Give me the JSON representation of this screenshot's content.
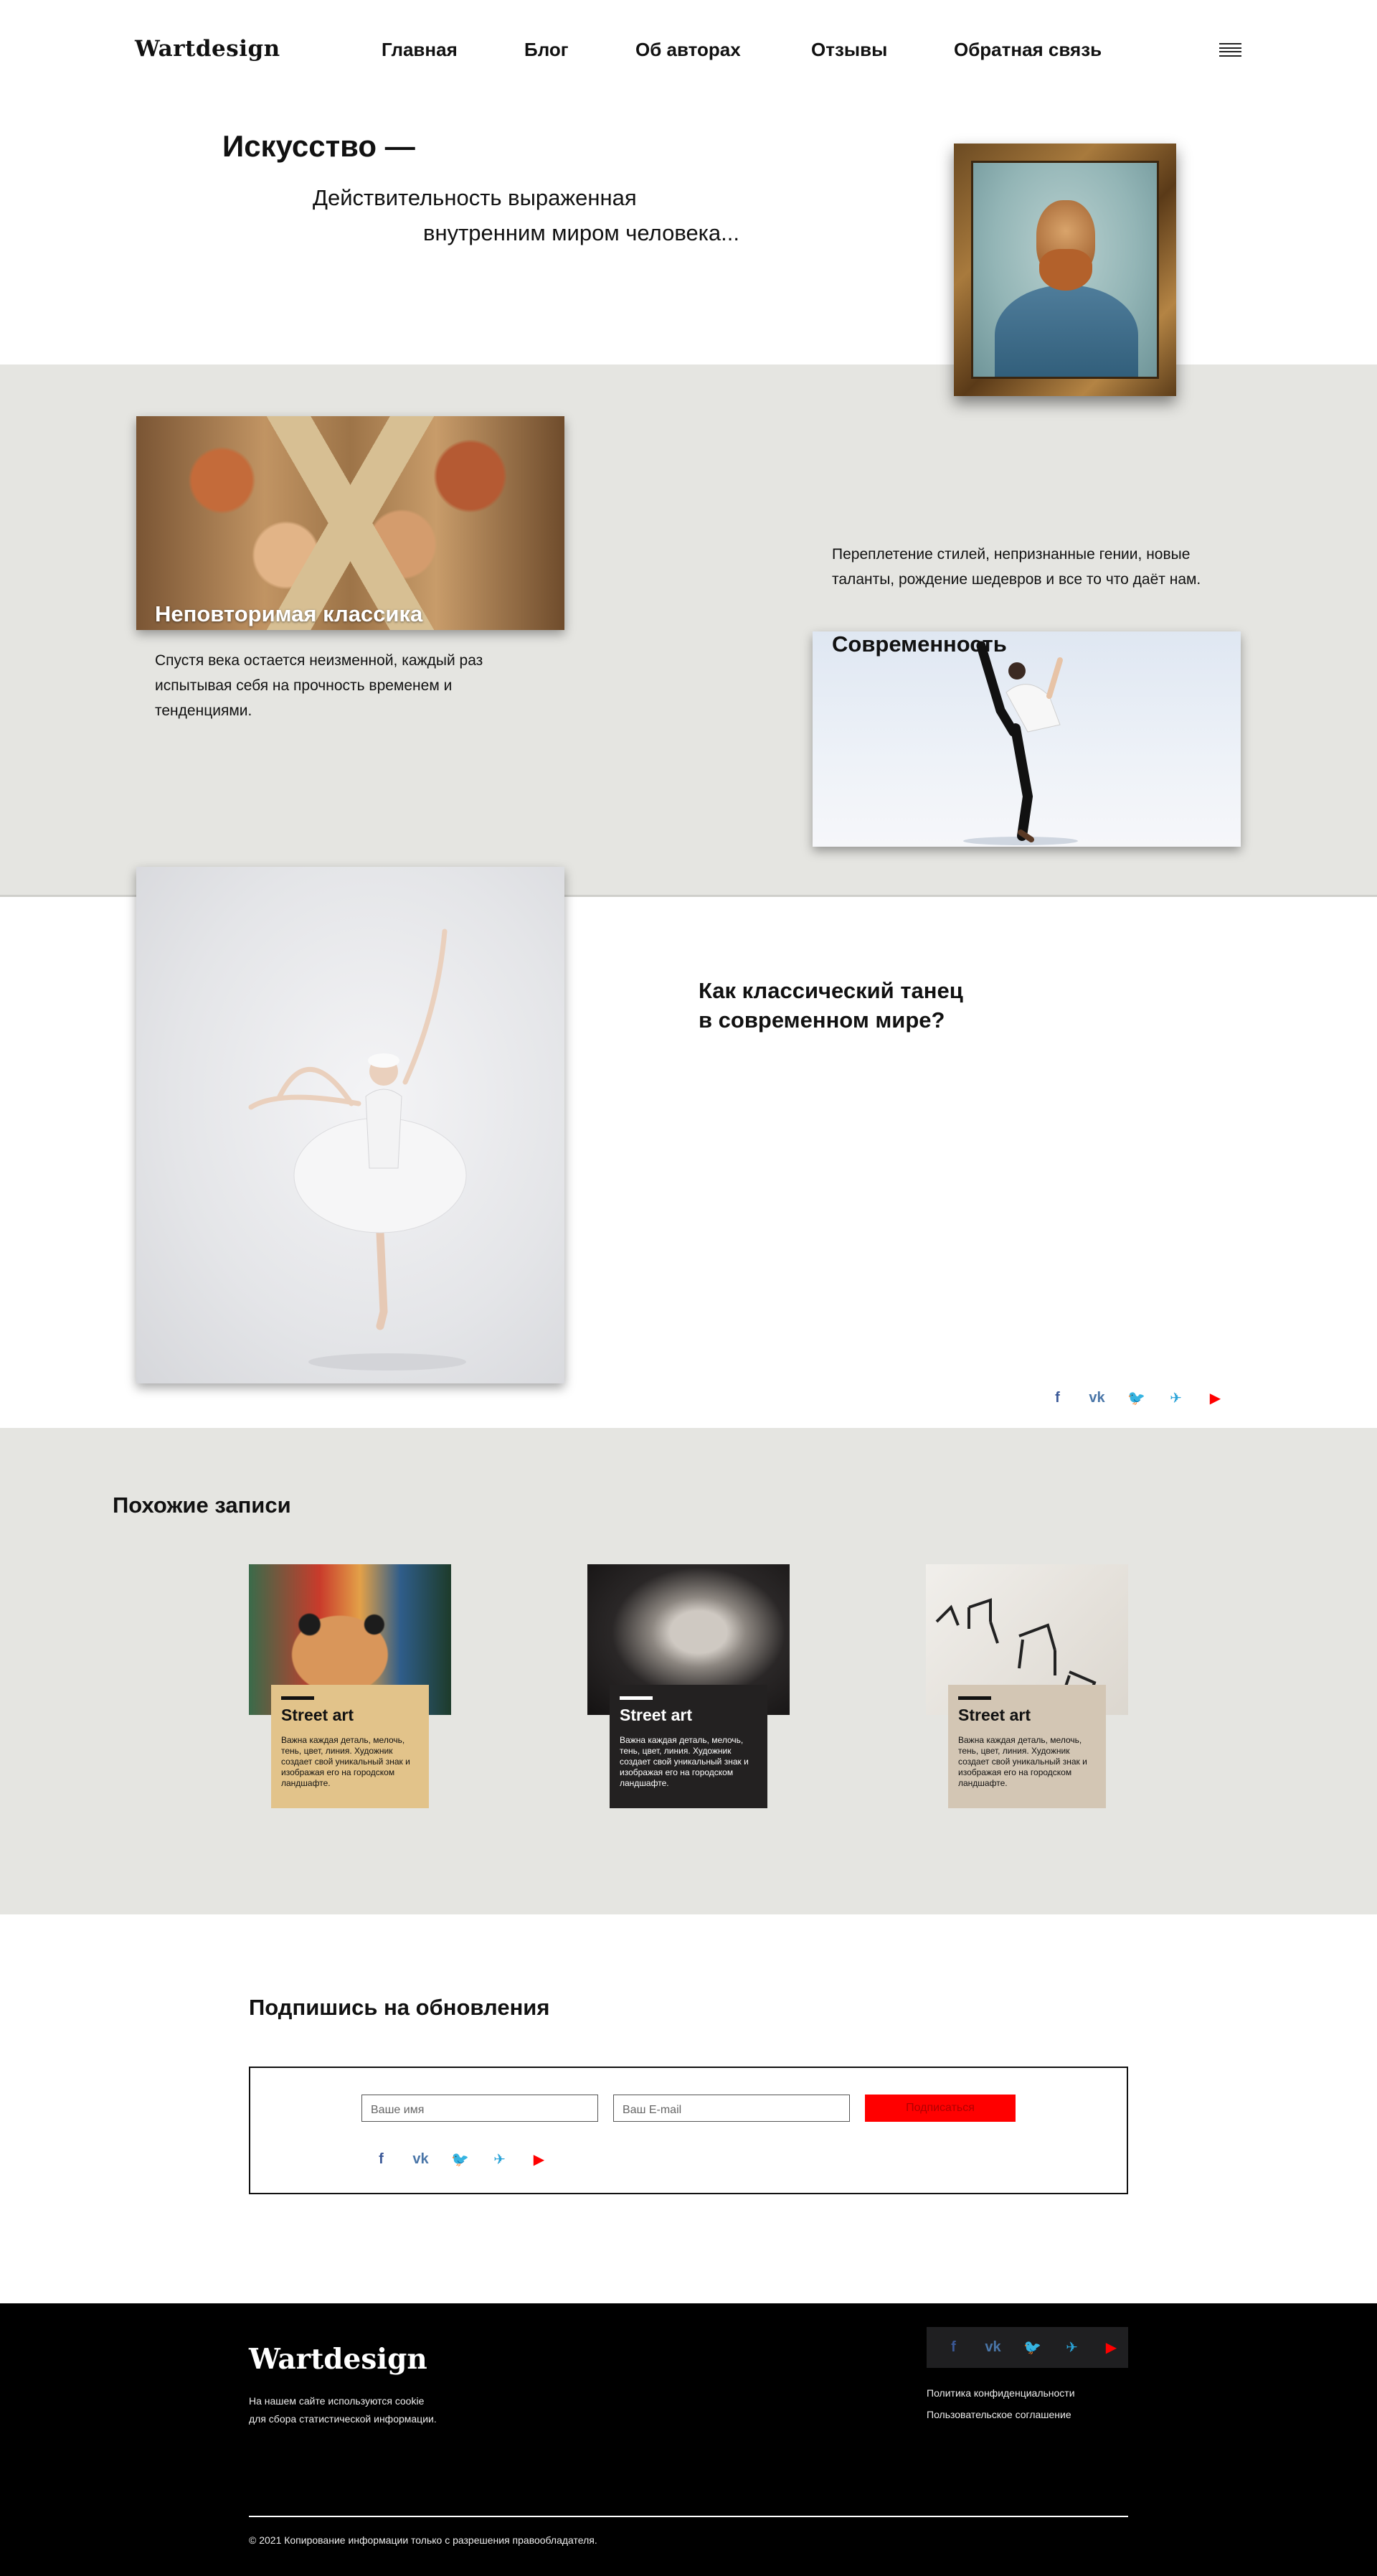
{
  "header": {
    "logo": "Wartdesign",
    "nav": [
      "Главная",
      "Блог",
      "Об авторах",
      "Отзывы",
      "Обратная связь"
    ]
  },
  "hero": {
    "title": "Искусство —",
    "line1": "Действительность выраженная",
    "line2": "внутренним миром человека..."
  },
  "features": {
    "classic_title": "Неповторимая классика",
    "classic_text": "Спустя века остается неизменной, каждый раз испытывая себя на прочность временем и тенденциями.",
    "modern_title": "Современность",
    "modern_text": "Переплетение стилей, непризнанные гении, новые таланты, рождение шедевров и все то что даёт нам."
  },
  "article": {
    "title_line1": "Как классический танец",
    "title_line2": "в современном мире?"
  },
  "social_icons": [
    "facebook-icon",
    "vk-icon",
    "twitter-icon",
    "telegram-icon",
    "youtube-icon"
  ],
  "social_glyphs": {
    "facebook": "f",
    "vk": "vk",
    "twitter": "🐦",
    "telegram": "✈",
    "youtube": "▶"
  },
  "related": {
    "title": "Похожие записи",
    "cards": [
      {
        "title": "Street art",
        "text": "Важна каждая деталь, мелочь, тень, цвет, линия. Художник создает свой уникальный знак и изображая его на городском ландшафте."
      },
      {
        "title": "Street art",
        "text": "Важна каждая деталь, мелочь, тень, цвет, линия. Художник создает свой уникальный знак и изображая его на городском ландшафте."
      },
      {
        "title": "Street art",
        "text": "Важна каждая деталь, мелочь, тень, цвет, линия. Художник создает свой уникальный знак и изображая его на городском ландшафте."
      }
    ]
  },
  "subscribe": {
    "title": "Подпишись на обновления",
    "name_placeholder": "Ваше имя",
    "email_placeholder": "Ваш E-mail",
    "button": "Подписаться"
  },
  "footer": {
    "logo": "Wartdesign",
    "cookie_line1": "На нашем сайте используются cookie",
    "cookie_line2": "для сбора статистической информации.",
    "privacy": "Политика конфиденциальности",
    "agreement": "Пользовательское соглашение",
    "copyright": "© 2021 Копирование информации только с разрешения правообладателя."
  },
  "colors": {
    "band": "#e5e5e1",
    "accent": "#ff0000",
    "footer_bg": "#000000",
    "card1": "#e2c38a",
    "card2": "#232121",
    "card3": "#d3c6b4"
  }
}
